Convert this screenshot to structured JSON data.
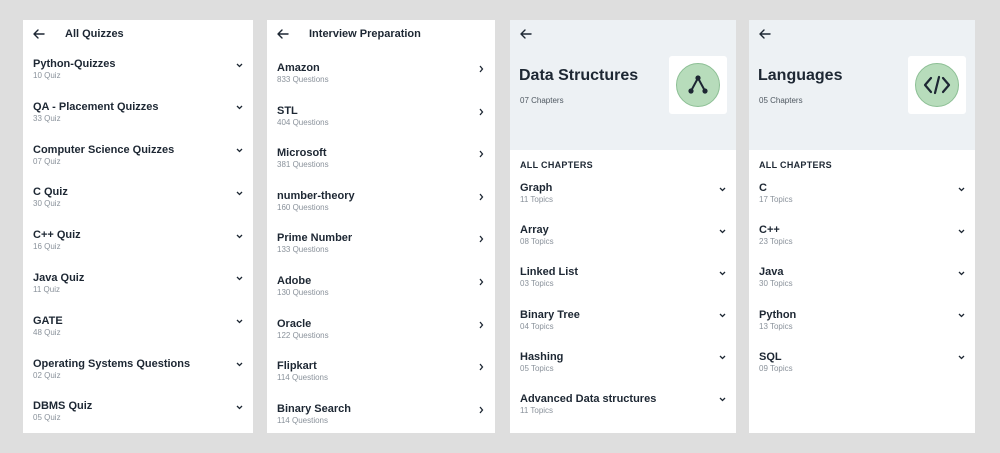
{
  "quizzes": {
    "title": "All Quizzes",
    "items": [
      {
        "title": "Python-Quizzes",
        "sub": "10 Quiz"
      },
      {
        "title": "QA - Placement Quizzes",
        "sub": "33 Quiz"
      },
      {
        "title": "Computer Science Quizzes",
        "sub": "07 Quiz"
      },
      {
        "title": "C Quiz",
        "sub": "30 Quiz"
      },
      {
        "title": "C++ Quiz",
        "sub": "16 Quiz"
      },
      {
        "title": "Java Quiz",
        "sub": "11 Quiz"
      },
      {
        "title": "GATE",
        "sub": "48 Quiz"
      },
      {
        "title": "Operating Systems Questions",
        "sub": "02 Quiz"
      },
      {
        "title": "DBMS Quiz",
        "sub": "05 Quiz"
      }
    ]
  },
  "interview": {
    "title": "Interview Preparation",
    "items": [
      {
        "title": "Amazon",
        "sub": "833 Questions"
      },
      {
        "title": "STL",
        "sub": "404 Questions"
      },
      {
        "title": "Microsoft",
        "sub": "381 Questions"
      },
      {
        "title": "number-theory",
        "sub": "160 Questions"
      },
      {
        "title": "Prime Number",
        "sub": "133 Questions"
      },
      {
        "title": "Adobe",
        "sub": "130 Questions"
      },
      {
        "title": "Oracle",
        "sub": "122 Questions"
      },
      {
        "title": "Flipkart",
        "sub": "114 Questions"
      },
      {
        "title": "Binary Search",
        "sub": "114 Questions"
      }
    ]
  },
  "data_structures": {
    "title": "Data Structures",
    "subtitle": "07 Chapters",
    "section_label": "ALL CHAPTERS",
    "items": [
      {
        "title": "Graph",
        "sub": "11 Topics"
      },
      {
        "title": "Array",
        "sub": "08 Topics"
      },
      {
        "title": "Linked List",
        "sub": "03 Topics"
      },
      {
        "title": "Binary Tree",
        "sub": "04 Topics"
      },
      {
        "title": "Hashing",
        "sub": "05 Topics"
      },
      {
        "title": "Advanced Data structures",
        "sub": "11 Topics"
      }
    ]
  },
  "languages": {
    "title": "Languages",
    "subtitle": "05 Chapters",
    "section_label": "ALL CHAPTERS",
    "items": [
      {
        "title": "C",
        "sub": "17 Topics"
      },
      {
        "title": "C++",
        "sub": "23 Topics"
      },
      {
        "title": "Java",
        "sub": "30 Topics"
      },
      {
        "title": "Python",
        "sub": "13 Topics"
      },
      {
        "title": "SQL",
        "sub": "09 Topics"
      }
    ]
  },
  "icons": {
    "back": "arrow-left-icon",
    "expand": "chevron-down-icon",
    "open": "chevron-right-icon",
    "ds_logo": "graph-nodes-icon",
    "lang_logo": "code-brackets-icon"
  },
  "colors": {
    "hero_bg": "#edf1f4",
    "logo_green": "#b7dcbb",
    "text_dark": "#1d2733",
    "text_muted": "#8a929b"
  }
}
